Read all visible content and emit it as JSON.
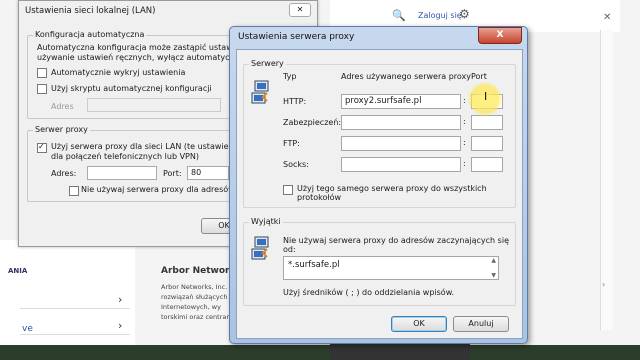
{
  "browser": {
    "login": "Zaloguj się",
    "left_menu_label": "ANIA",
    "left_link": "ve",
    "company_title": "Arbor Networks",
    "company_text": "Arbor Networks, Inc. rozwiązań służących Internetowych, wy torskimi oraz centrami"
  },
  "lan_dialog": {
    "title": "Ustawienia sieci lokalnej (LAN)",
    "auto_group": "Konfiguracja automatyczna",
    "auto_desc_1": "Automatyczna konfiguracja może zastąpić ustawienia ręczne.",
    "auto_desc_2": "używanie ustawień ręcznych, wyłącz automatyczną konf",
    "auto_detect": "Automatycznie wykryj ustawienia",
    "use_script": "Użyj skryptu automatycznej konfiguracji",
    "address_label": "Adres",
    "proxy_group": "Serwer proxy",
    "use_proxy_1": "Użyj serwera proxy dla sieci LAN (te ustawienia nie są",
    "use_proxy_2": "dla połączeń telefonicznych lub VPN)",
    "addr_label": "Adres:",
    "port_label": "Port:",
    "port_value": "80",
    "bypass_local": "Nie używaj serwera proxy dla adresów lokalnych",
    "ok": "OK"
  },
  "proxy_dialog": {
    "title": "Ustawienia serwera proxy",
    "close_glyph": "X",
    "servers_group": "Serwery",
    "col_type": "Typ",
    "col_address": "Adres używanego serwera proxy",
    "col_port": "Port",
    "rows": [
      {
        "label": "HTTP:",
        "address": "proxy2.surfsafe.pl",
        "port": ""
      },
      {
        "label": "Zabezpieczeń:",
        "address": "",
        "port": ""
      },
      {
        "label": "FTP:",
        "address": "",
        "port": ""
      },
      {
        "label": "Socks:",
        "address": "",
        "port": ""
      }
    ],
    "colon": ":",
    "same_proxy": "Użyj tego samego serwera proxy do wszystkich protokołów",
    "exceptions_group": "Wyjątki",
    "exceptions_desc": "Nie używaj serwera proxy do adresów zaczynających się od:",
    "exceptions_value": "*.surfsafe.pl",
    "semicolon_hint": "Użyj średników ( ; ) do oddzielania wpisów.",
    "ok": "OK",
    "cancel": "Anuluj"
  }
}
